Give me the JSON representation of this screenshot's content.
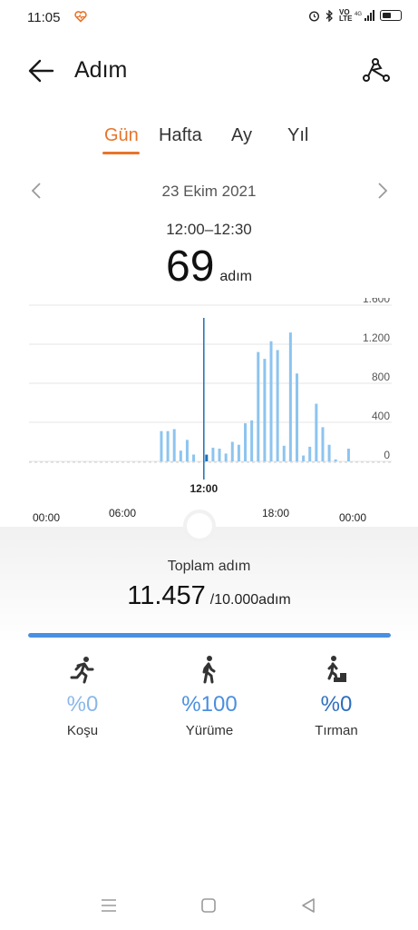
{
  "status_bar": {
    "time": "11:05",
    "icons": [
      "alarm-icon",
      "bluetooth-icon",
      "volte-icon",
      "4g-signal-icon",
      "battery-icon"
    ]
  },
  "header": {
    "title": "Adım",
    "back_icon": "arrow-left-icon",
    "share_icon": "share-route-icon"
  },
  "tabs": [
    {
      "label": "Gün",
      "active": true
    },
    {
      "label": "Hafta",
      "active": false
    },
    {
      "label": "Ay",
      "active": false
    },
    {
      "label": "Yıl",
      "active": false
    }
  ],
  "date_nav": {
    "date": "23 Ekim 2021",
    "prev_icon": "chevron-left-icon",
    "next_icon": "chevron-right-icon"
  },
  "selection": {
    "time_range": "12:00–12:30",
    "value": "69",
    "unit": "adım"
  },
  "chart_data": {
    "type": "bar",
    "y_ticks": [
      "1.600",
      "1.200",
      "800",
      "400",
      "0"
    ],
    "ylim": [
      0,
      1600
    ],
    "x_ticks": [
      "00:00",
      "06:00",
      "12:00",
      "18:00",
      "00:00"
    ],
    "selected_x": "12:00",
    "bar_color": "#8dc4ef",
    "selected_color": "#1e6fb8",
    "bars": [
      {
        "slot": 20,
        "value": 310
      },
      {
        "slot": 21,
        "value": 310
      },
      {
        "slot": 22,
        "value": 330
      },
      {
        "slot": 23,
        "value": 110
      },
      {
        "slot": 24,
        "value": 220
      },
      {
        "slot": 25,
        "value": 70
      },
      {
        "slot": 26,
        "value": 0
      },
      {
        "slot": 27,
        "value": 69,
        "selected": true
      },
      {
        "slot": 28,
        "value": 140
      },
      {
        "slot": 29,
        "value": 130
      },
      {
        "slot": 30,
        "value": 80
      },
      {
        "slot": 31,
        "value": 200
      },
      {
        "slot": 32,
        "value": 170
      },
      {
        "slot": 33,
        "value": 390
      },
      {
        "slot": 34,
        "value": 420
      },
      {
        "slot": 35,
        "value": 1120
      },
      {
        "slot": 36,
        "value": 1050
      },
      {
        "slot": 37,
        "value": 1230
      },
      {
        "slot": 38,
        "value": 1140
      },
      {
        "slot": 39,
        "value": 160
      },
      {
        "slot": 40,
        "value": 1320
      },
      {
        "slot": 41,
        "value": 900
      },
      {
        "slot": 42,
        "value": 60
      },
      {
        "slot": 43,
        "value": 150
      },
      {
        "slot": 44,
        "value": 590
      },
      {
        "slot": 45,
        "value": 350
      },
      {
        "slot": 46,
        "value": 170
      },
      {
        "slot": 47,
        "value": 20
      },
      {
        "slot": 49,
        "value": 130
      }
    ]
  },
  "summary": {
    "title": "Toplam adım",
    "total": "11.457",
    "goal": "/10.000adım",
    "progress": 1.0,
    "progress_color": "#4a8fe0"
  },
  "activities": [
    {
      "icon": "running-icon",
      "pct": "%0",
      "label": "Koşu",
      "color": "#8ab8e8"
    },
    {
      "icon": "walking-icon",
      "pct": "%100",
      "label": "Yürüme",
      "color": "#4a8fe0"
    },
    {
      "icon": "climbing-icon",
      "pct": "%0",
      "label": "Tırman",
      "color": "#2e6fbf"
    }
  ],
  "nav_bar": {
    "icons": [
      "menu-icon",
      "home-square-icon",
      "back-triangle-icon"
    ]
  }
}
